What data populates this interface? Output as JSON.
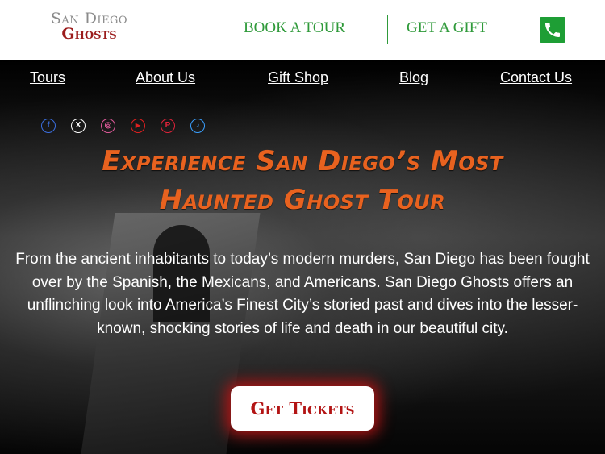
{
  "brand": {
    "logo_line1": "San Diego",
    "logo_line2": "Ghosts"
  },
  "topbar": {
    "book_label": "BOOK A TOUR",
    "gift_label": "GET A GIFT",
    "phone_icon": "phone-icon"
  },
  "nav": {
    "items": [
      {
        "label": "Tours"
      },
      {
        "label": "About Us"
      },
      {
        "label": "Gift Shop"
      },
      {
        "label": "Blog"
      },
      {
        "label": "Contact Us"
      }
    ]
  },
  "socials": [
    {
      "name": "facebook-icon",
      "glyph": "f",
      "color": "#3b6fe0"
    },
    {
      "name": "x-twitter-icon",
      "glyph": "X",
      "color": "#ffffff"
    },
    {
      "name": "instagram-icon",
      "glyph": "◎",
      "color": "#e05a9a"
    },
    {
      "name": "youtube-icon",
      "glyph": "▶",
      "color": "#e02020"
    },
    {
      "name": "pinterest-icon",
      "glyph": "P",
      "color": "#e0233a"
    },
    {
      "name": "tiktok-icon",
      "glyph": "♪",
      "color": "#3aa0ff"
    }
  ],
  "hero": {
    "headline_line1": "Experience San Diego’s Most",
    "headline_line2": "Haunted Ghost Tour",
    "body": "From the ancient inhabitants to today’s modern murders, San Diego has been fought over by the Spanish, the Mexicans, and Americans. San Diego Ghosts offers an unflinching look into America’s Finest City’s storied past and dives into the lesser-known, shocking stories of life and death in our beautiful city.",
    "cta_label": "Get Tickets"
  },
  "colors": {
    "accent_green": "#2f9a3a",
    "headline_orange": "#e8621f",
    "cta_red": "#b31414"
  }
}
